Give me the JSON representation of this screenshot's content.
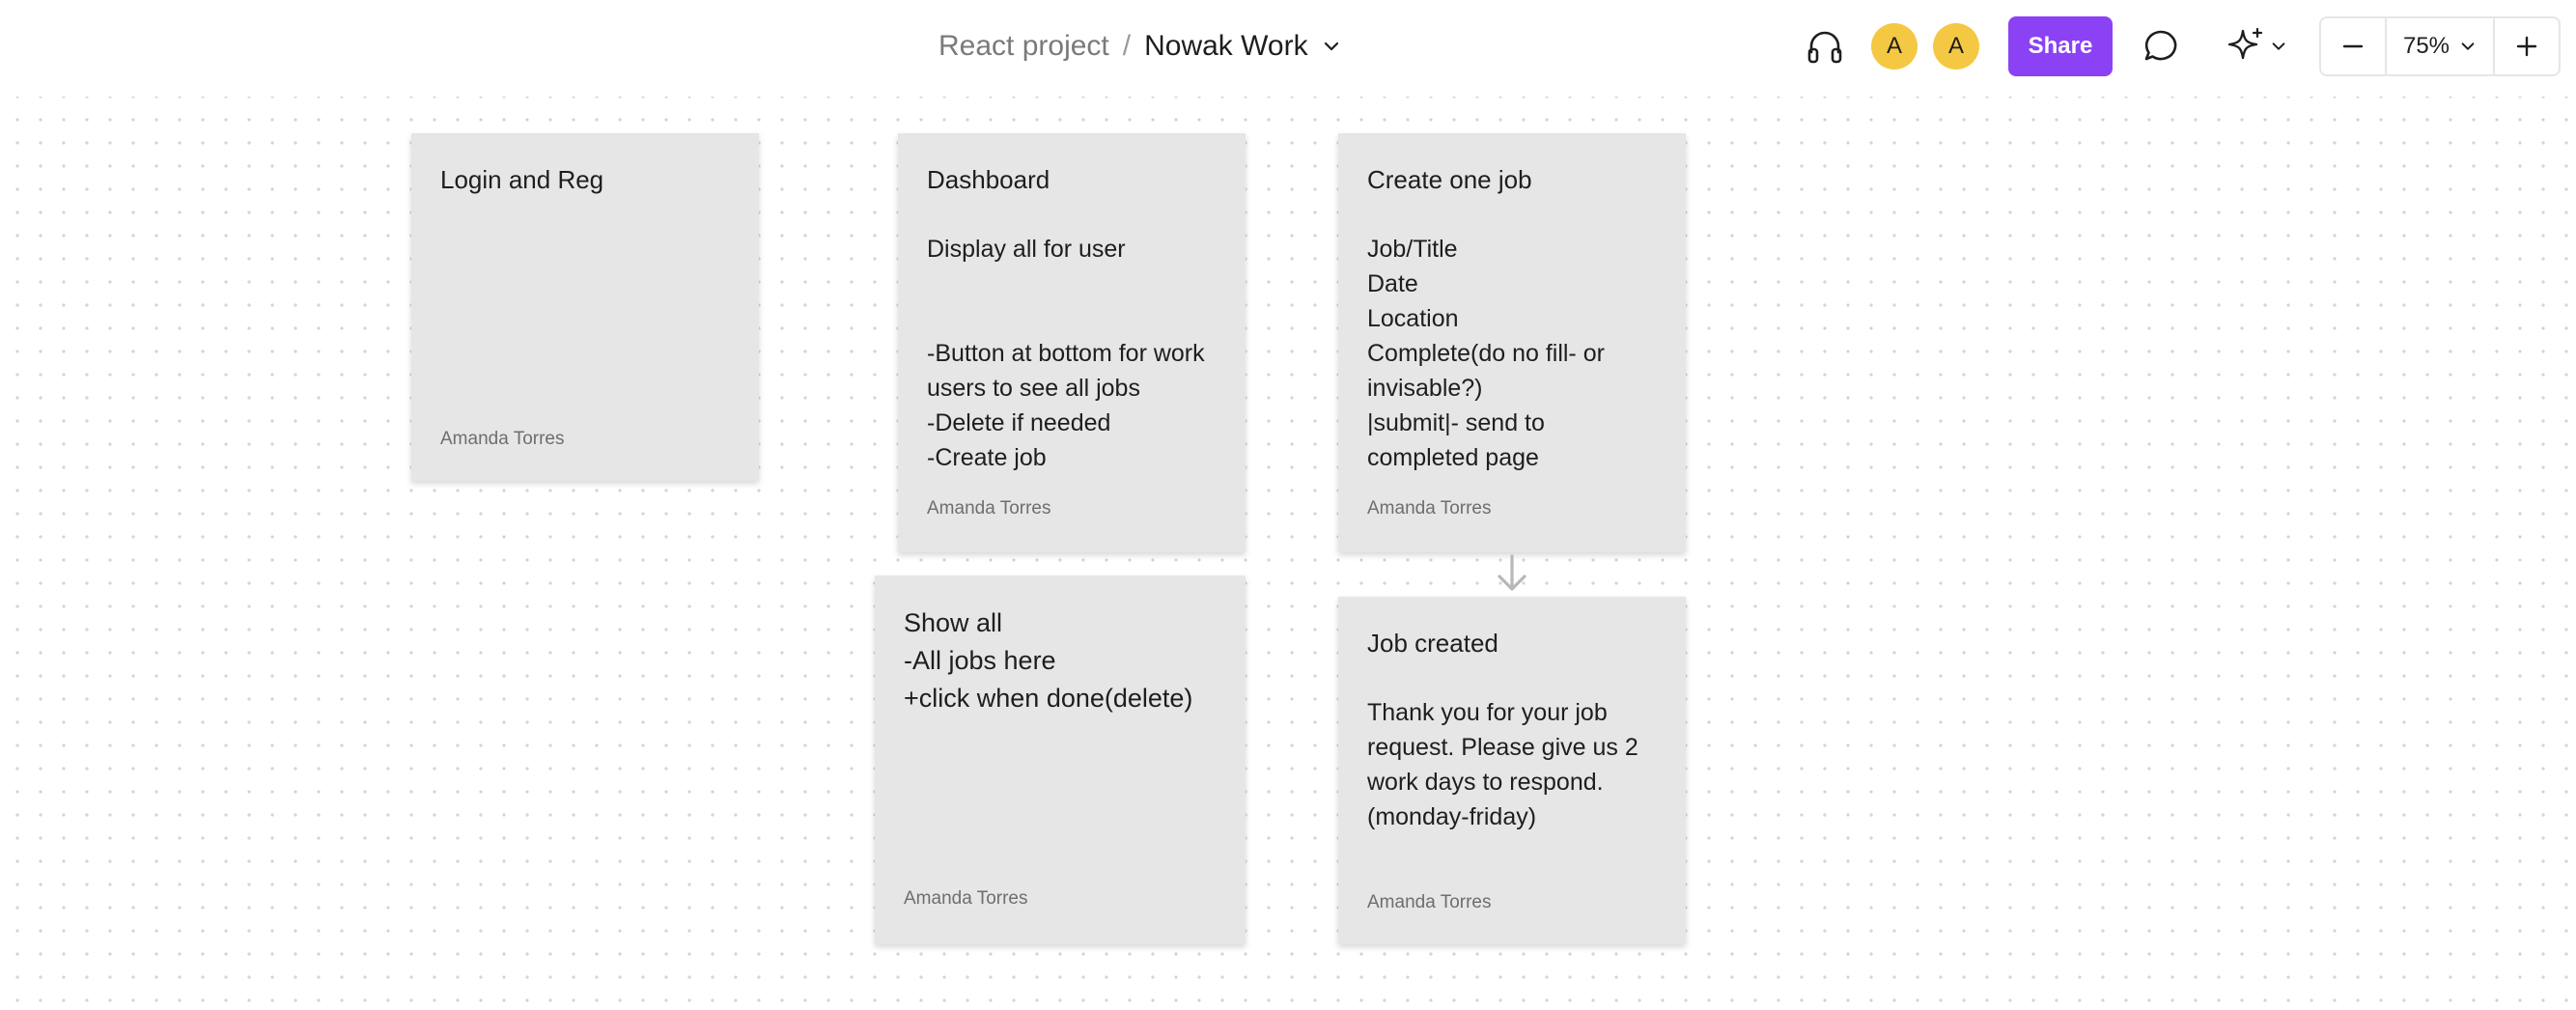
{
  "header": {
    "breadcrumb_parent": "React project",
    "breadcrumb_separator": "/",
    "board_title": "Nowak Work",
    "avatars": [
      {
        "initial": "A"
      },
      {
        "initial": "A"
      }
    ],
    "share_label": "Share",
    "zoom_level": "75%",
    "icons": [
      "headphones-icon",
      "comment-icon",
      "sparkle-ai-icon",
      "minus-icon",
      "plus-icon",
      "chevron-down-icon"
    ]
  },
  "colors": {
    "accent": "#8b42f5",
    "avatar": "#f5c843",
    "sticky": "#e6e6e6"
  },
  "cards": {
    "login": {
      "title": "Login and Reg",
      "body": "",
      "author": "Amanda Torres"
    },
    "dashboard": {
      "title": "Dashboard",
      "body": "Display all for user\n\n\n-Button at bottom for work users to see all jobs\n-Delete if needed\n-Create job",
      "author": "Amanda Torres"
    },
    "create_job": {
      "title": "Create one job",
      "body": "Job/Title\nDate\nLocation\nComplete(do no fill- or invisable?)\n|submit|- send to completed page",
      "author": "Amanda Torres"
    },
    "show_all": {
      "title": "Show all\n-All jobs here\n+click when done(delete)",
      "author": "Amanda Torres"
    },
    "job_created": {
      "title": "Job created",
      "body": "Thank you for your job request. Please give us 2 work days to respond. (monday-friday)",
      "author": "Amanda Torres"
    }
  }
}
